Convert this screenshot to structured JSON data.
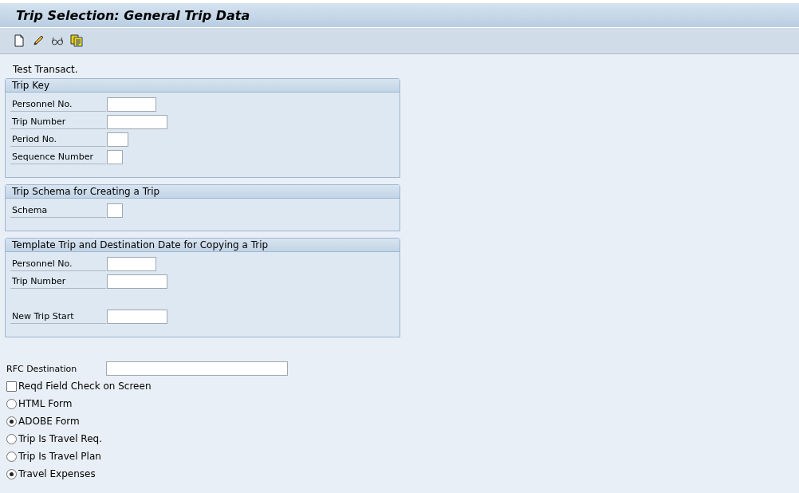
{
  "window": {
    "title": "Trip Selection: General Trip Data"
  },
  "toolbar": {
    "buttons": [
      {
        "kind": "create"
      },
      {
        "kind": "change"
      },
      {
        "kind": "display"
      },
      {
        "kind": "copy"
      }
    ]
  },
  "test_label": "Test Transact.",
  "groups": [
    {
      "title": "Trip Key",
      "fields": [
        {
          "label": "Personnel No."
        },
        {
          "label": "Trip Number"
        },
        {
          "label": "Period No."
        },
        {
          "label": "Sequence Number"
        }
      ]
    },
    {
      "title": "Trip Schema for Creating a Trip",
      "fields": [
        {
          "label": "Schema"
        }
      ]
    },
    {
      "title": "Template Trip and Destination Date for Copying a Trip",
      "fields": [
        {
          "label": "Personnel No."
        },
        {
          "label": "Trip Number"
        },
        {
          "label": "New Trip Start"
        }
      ]
    }
  ],
  "rfc_destination": {
    "label": "RFC Destination"
  },
  "options": [
    {
      "kind": "checkbox",
      "label": "Reqd Field Check on Screen",
      "checked": false
    },
    {
      "kind": "radio",
      "label": "HTML Form",
      "selected": false
    },
    {
      "kind": "radio",
      "label": "ADOBE Form",
      "selected": true
    },
    {
      "kind": "radio",
      "label": "Trip Is Travel Req.",
      "selected": false
    },
    {
      "kind": "radio",
      "label": "Trip Is Travel Plan",
      "selected": false
    },
    {
      "kind": "radio",
      "label": "Travel Expenses",
      "selected": true
    }
  ]
}
